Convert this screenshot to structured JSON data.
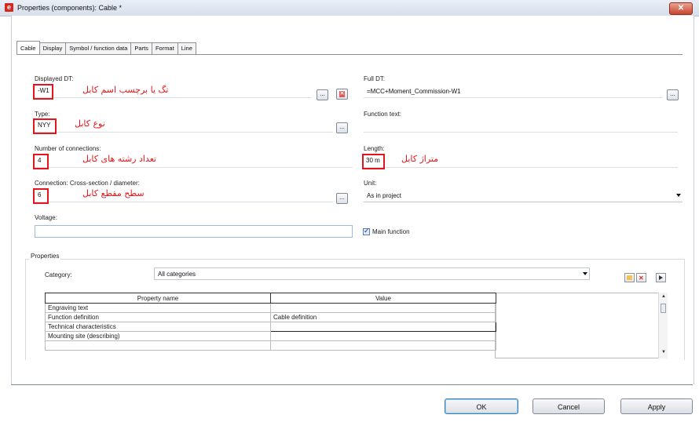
{
  "window": {
    "title": "Properties (components): Cable *",
    "icon": "app-e-icon",
    "close": "✕"
  },
  "tabs": [
    {
      "label": "Cable",
      "active": true
    },
    {
      "label": "Display"
    },
    {
      "label": "Symbol / function data"
    },
    {
      "label": "Parts"
    },
    {
      "label": "Format"
    },
    {
      "label": "Line"
    }
  ],
  "fields": {
    "displayed_dt": {
      "label": "Displayed DT:",
      "value": "-W1",
      "note": "تگ یا برچسب اسم کابل"
    },
    "full_dt": {
      "label": "Full DT:",
      "value": "=MCC+Moment_Commission-W1"
    },
    "type": {
      "label": "Type:",
      "value": "NYY",
      "note": "نوع کابل"
    },
    "function_text": {
      "label": "Function text:",
      "value": ""
    },
    "connections": {
      "label": "Number of connections:",
      "value": "4",
      "note": "تعداد رشته های کابل"
    },
    "length": {
      "label": "Length:",
      "value": "30 m",
      "note": "متراژ کابل"
    },
    "cross_section": {
      "label": "Connection: Cross-section / diameter:",
      "value": "6",
      "note": "سطح مقطع کابل"
    },
    "unit": {
      "label": "Unit:",
      "value": "As in project"
    },
    "voltage": {
      "label": "Voltage:",
      "value": ""
    },
    "main_function": {
      "label": "Main function",
      "checked": true
    }
  },
  "browse_label": "...",
  "properties": {
    "group_label": "Properties",
    "category_label": "Category:",
    "category_value": "All categories",
    "columns": [
      "Property name",
      "Value"
    ],
    "rows": [
      {
        "name": "Engraving text",
        "value": ""
      },
      {
        "name": "Function definition",
        "value": "Cable definition"
      },
      {
        "name": "Technical characteristics",
        "value": ""
      },
      {
        "name": "Mounting site (describing)",
        "value": ""
      },
      {
        "name": "",
        "value": ""
      }
    ]
  },
  "buttons": {
    "ok": "OK",
    "cancel": "Cancel",
    "apply": "Apply"
  },
  "colors": {
    "annotation": "#e4161b",
    "titlebar": "#dfe6f1"
  }
}
